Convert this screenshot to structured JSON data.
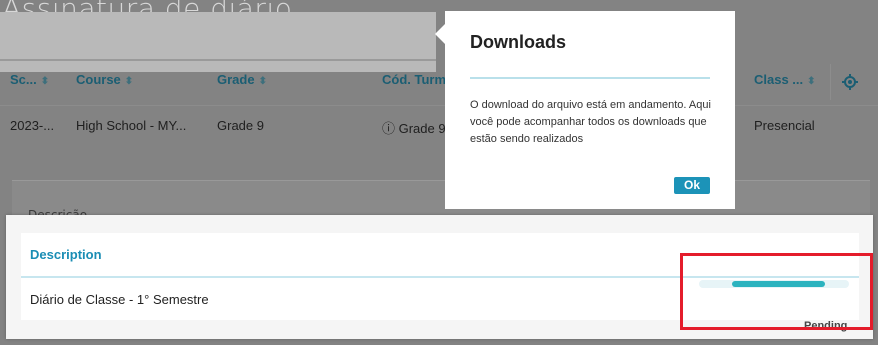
{
  "page": {
    "title": "Assinatura de diário"
  },
  "table": {
    "headers": [
      "Sc...",
      "Course",
      "Grade",
      "Cód. Turm",
      "Class ..."
    ],
    "row": [
      "2023-...",
      "High School - MY...",
      "Grade 9",
      "ⓘ Grade 9",
      "Presencial"
    ]
  },
  "background_card": {
    "partial_text": "Descrição"
  },
  "modal": {
    "title": "Downloads",
    "body": "O download do arquivo está em andamento. Aqui você pode acompanhar todos os downloads que estão sendo realizados",
    "ok_label": "Ok"
  },
  "downloads": {
    "column_header": "Description",
    "item_description": "Diário de Classe - 1° Semestre",
    "status": "Pending",
    "progress_percent": 68
  },
  "colors": {
    "accent": "#1a8db4",
    "progress": "#2bb3bf",
    "highlight": "#e41c2b"
  }
}
